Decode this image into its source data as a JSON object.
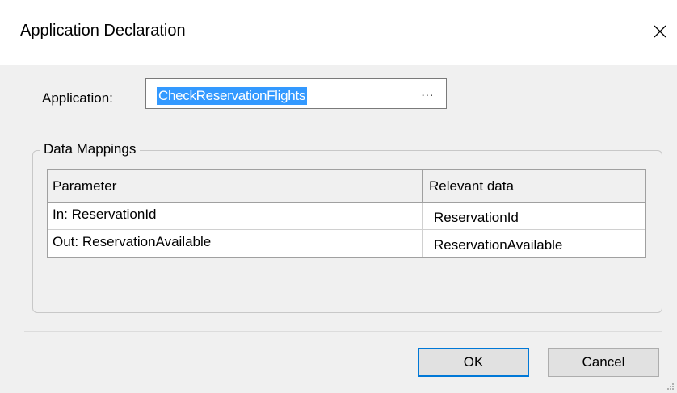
{
  "window": {
    "title": "Application Declaration",
    "close_icon": "close-icon"
  },
  "application": {
    "label": "Application:",
    "value": "CheckReservationFlights",
    "browse_label": "..."
  },
  "data_mappings": {
    "group_title": "Data Mappings",
    "columns": [
      "Parameter",
      "Relevant data"
    ],
    "rows": [
      [
        "In: ReservationId",
        "ReservationId"
      ],
      [
        "Out: ReservationAvailable",
        "ReservationAvailable"
      ]
    ]
  },
  "buttons": {
    "ok": "OK",
    "cancel": "Cancel"
  },
  "colors": {
    "selection": "#3399ff",
    "focus_border": "#0078d7",
    "dialog_background": "#f0f0f0"
  }
}
